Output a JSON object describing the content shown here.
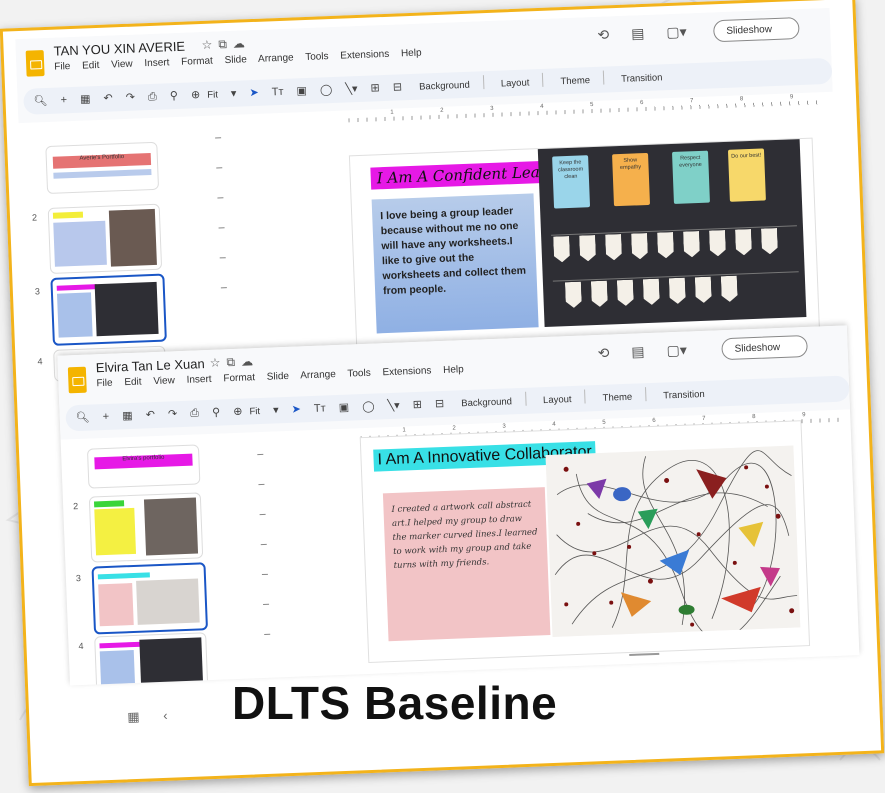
{
  "caption": "DLTS Baseline",
  "colors": {
    "frame": "#f3b31b",
    "leader_highlight": "#e619e6",
    "innovative_highlight": "#38e0e6",
    "blue_box": "#9fbde8",
    "pink_box": "#f2c4c6",
    "selection": "#1a56c6",
    "app_logo": "#f4b400"
  },
  "menu_items": [
    "File",
    "Edit",
    "View",
    "Insert",
    "Format",
    "Slide",
    "Arrange",
    "Tools",
    "Extensions",
    "Help"
  ],
  "toolbar": {
    "fit_label": "Fit",
    "background": "Background",
    "layout": "Layout",
    "theme": "Theme",
    "transition": "Transition"
  },
  "slideshow_label": "Slideshow",
  "ruler_numbers": [
    "1",
    "2",
    "3",
    "4",
    "5",
    "6",
    "7",
    "8",
    "9"
  ],
  "screen1": {
    "doc_title": "TAN YOU XIN AVERIE",
    "thumb1_label": "Averie's Portfolio",
    "thumb_numbers": [
      "2",
      "3",
      "4"
    ],
    "slide_title": "I Am A Confident Leader",
    "slide_text": "I love being a group leader because without me no one will have any worksheets.I like to give out the worksheets and collect them from people.",
    "posters": [
      "Keep the classroom clean",
      "Show empathy",
      "Respect everyone",
      "Do our best!"
    ]
  },
  "screen2": {
    "doc_title": "Elvira Tan Le Xuan",
    "thumb1_label": "Elvira's portfolio",
    "thumb_numbers": [
      "2",
      "3",
      "4"
    ],
    "slide_title": "I Am A Innovative Collaborator",
    "slide_text": "I created a artwork call abstract art.I helped my group to draw the marker curved lines.I learned to work with my group and take turns with my friends."
  }
}
